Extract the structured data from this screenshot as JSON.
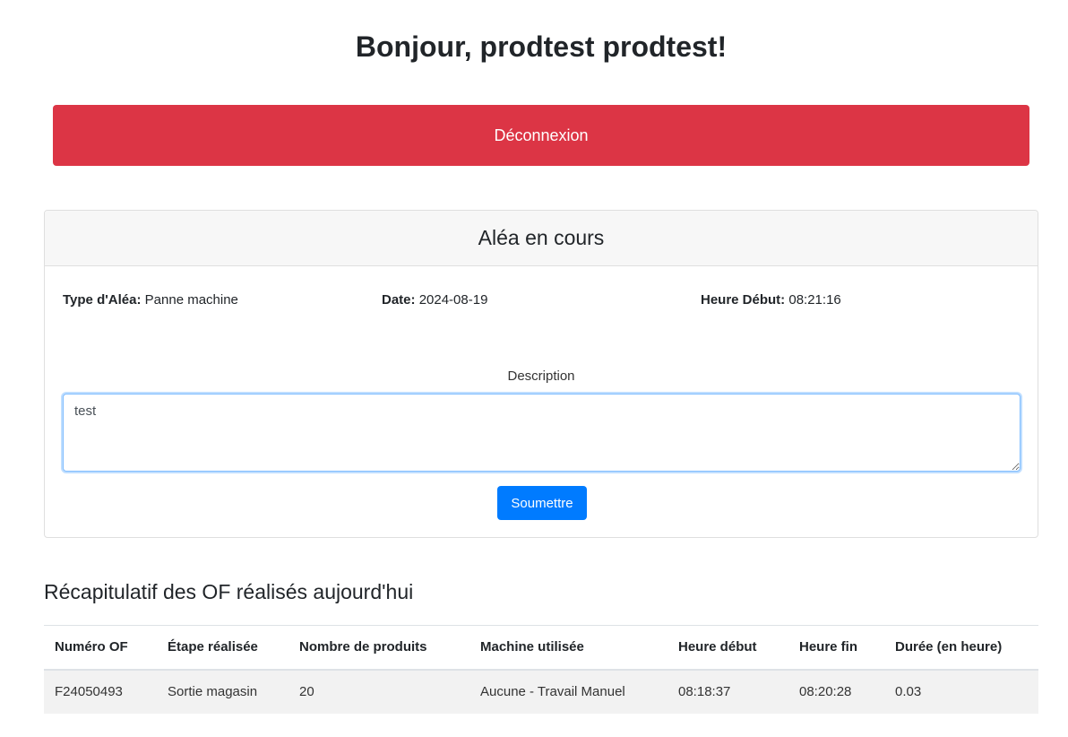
{
  "greeting": "Bonjour, prodtest prodtest!",
  "logout_label": "Déconnexion",
  "colors": {
    "danger": "#dc3545",
    "primary": "#007bff"
  },
  "alea": {
    "header": "Aléa en cours",
    "type_label": "Type d'Aléa:",
    "type_value": "Panne machine",
    "date_label": "Date:",
    "date_value": "2024-08-19",
    "start_label": "Heure Début:",
    "start_value": "08:21:16",
    "description_label": "Description",
    "description_value": "test",
    "submit_label": "Soumettre"
  },
  "summary": {
    "title": "Récapitulatif des OF réalisés aujourd'hui",
    "columns": [
      "Numéro OF",
      "Étape réalisée",
      "Nombre de produits",
      "Machine utilisée",
      "Heure début",
      "Heure fin",
      "Durée (en heure)"
    ],
    "rows": [
      [
        "F24050493",
        "Sortie magasin",
        "20",
        "Aucune - Travail Manuel",
        "08:18:37",
        "08:20:28",
        "0.03"
      ]
    ]
  }
}
